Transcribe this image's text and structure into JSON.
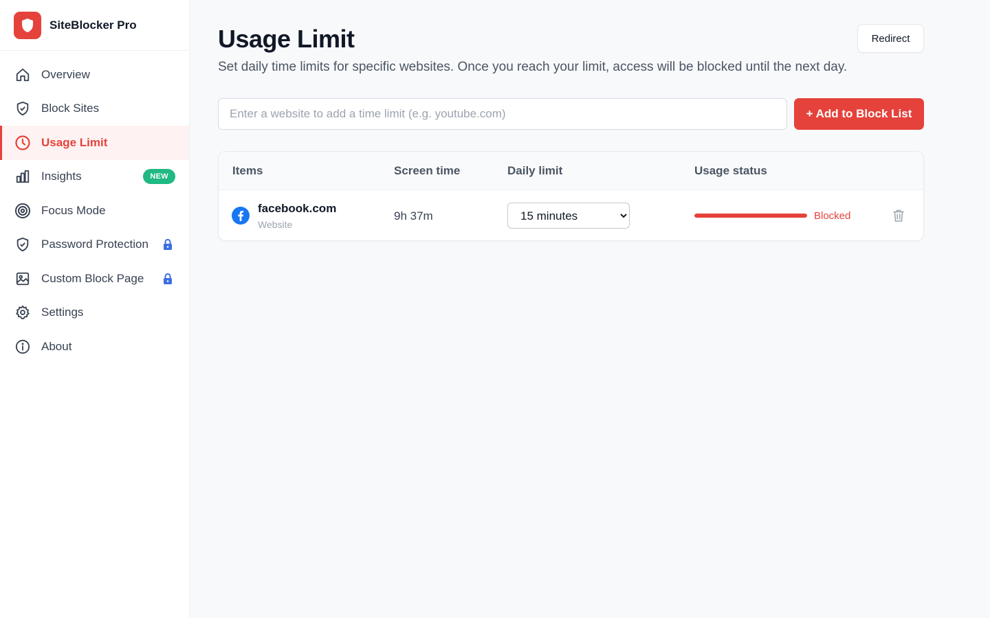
{
  "app": {
    "name": "SiteBlocker Pro"
  },
  "sidebar": {
    "items": [
      {
        "label": "Overview",
        "icon": "home-icon"
      },
      {
        "label": "Block Sites",
        "icon": "shield-icon"
      },
      {
        "label": "Usage Limit",
        "icon": "clock-icon",
        "active": true
      },
      {
        "label": "Insights",
        "icon": "bar-chart-icon",
        "badge": "NEW"
      },
      {
        "label": "Focus Mode",
        "icon": "target-icon"
      },
      {
        "label": "Password Protection",
        "icon": "shield-check-icon",
        "locked": true
      },
      {
        "label": "Custom Block Page",
        "icon": "image-icon",
        "locked": true
      },
      {
        "label": "Settings",
        "icon": "gear-icon"
      },
      {
        "label": "About",
        "icon": "info-icon"
      }
    ]
  },
  "page": {
    "title": "Usage Limit",
    "description": "Set daily time limits for specific websites. Once you reach your limit, access will be blocked until the next day.",
    "redirect_label": "Redirect",
    "input_placeholder": "Enter a website to add a time limit (e.g. youtube.com)",
    "input_value": "",
    "add_button_label": "+ Add to Block List"
  },
  "table": {
    "headers": [
      "Items",
      "Screen time",
      "Daily limit",
      "Usage status"
    ],
    "rows": [
      {
        "site": "facebook.com",
        "type": "Website",
        "screen_time": "9h 37m",
        "daily_limit": "15 minutes",
        "usage_fraction": 1.0,
        "status": "Blocked"
      }
    ]
  },
  "colors": {
    "accent": "#e5423b",
    "badge_green": "#1fb981",
    "lock_blue": "#3b6fe0",
    "facebook_blue": "#1877f2"
  }
}
